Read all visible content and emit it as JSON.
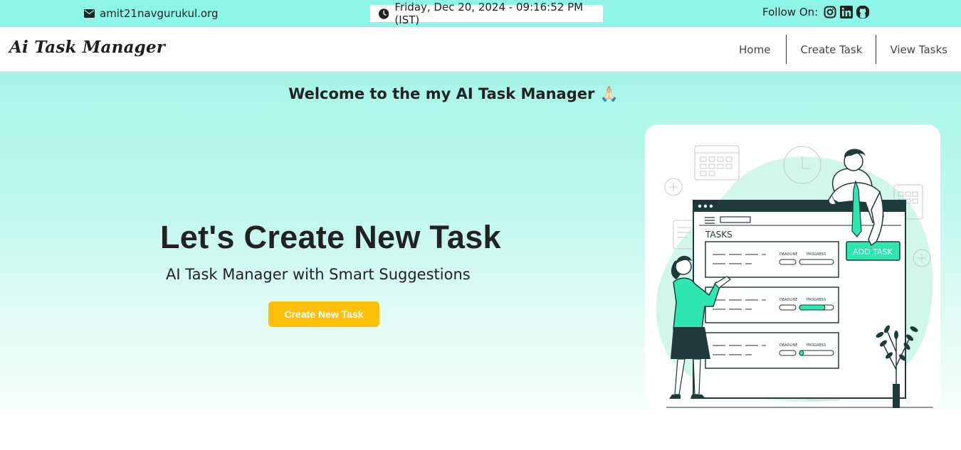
{
  "topbar": {
    "email": "amit21navgurukul.org",
    "datetime": "Friday, Dec 20, 2024 - 09:16:52 PM (IST)",
    "follow_label": "Follow On:",
    "social_icons": [
      "instagram-icon",
      "linkedin-icon",
      "github-icon"
    ]
  },
  "nav": {
    "brand": "Ai Task Manager",
    "links": [
      "Home",
      "Create Task",
      "View Tasks"
    ]
  },
  "hero": {
    "welcome": "Welcome to the my AI Task Manager 🙏🏻",
    "headline": "Let's Create New Task",
    "subline": "AI Task Manager with Smart Suggestions",
    "cta_label": "Create New Task"
  },
  "illustration": {
    "header": "TASKS",
    "add_button": "ADD TASK",
    "deadline_label": "DEADLINE",
    "progress_label": "PROGRESS",
    "task_progress": [
      0,
      0.75,
      0.12
    ]
  },
  "colors": {
    "topbar": "#8ef5e6",
    "accent": "#2ee6b0",
    "cta": "#ffc107",
    "dark": "#1e3a3a"
  }
}
